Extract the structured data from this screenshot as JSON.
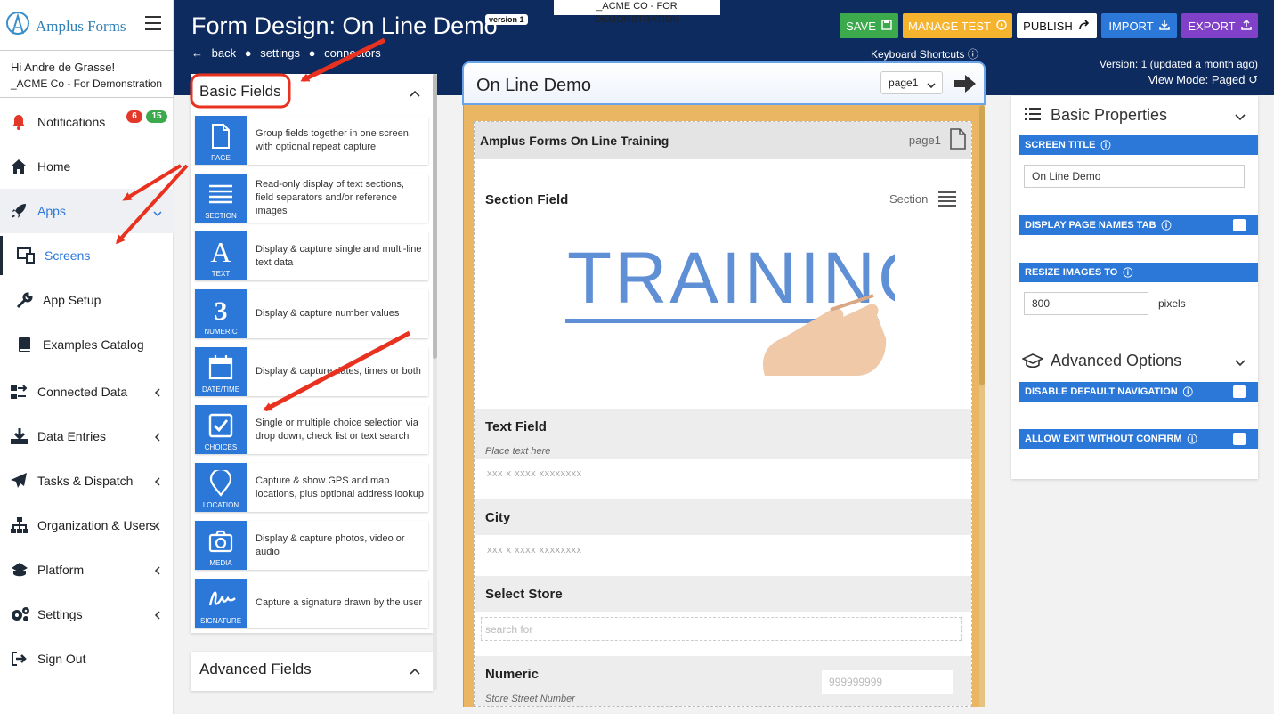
{
  "app": {
    "name": "Amplus Forms"
  },
  "sidebar": {
    "greeting": "Hi Andre de Grasse!",
    "company": "_ACME Co - For Demonstration",
    "items": [
      {
        "label": "Notifications",
        "icon": "bell-icon",
        "badges": [
          "6",
          "15"
        ]
      },
      {
        "label": "Home",
        "icon": "home-icon"
      },
      {
        "label": "Apps",
        "icon": "rocket-icon"
      },
      {
        "label": "Screens",
        "icon": "screens-icon"
      },
      {
        "label": "App Setup",
        "icon": "wrench-icon"
      },
      {
        "label": "Examples Catalog",
        "icon": "book-icon"
      },
      {
        "label": "Connected Data",
        "icon": "connected-data-icon"
      },
      {
        "label": "Data Entries",
        "icon": "download-icon"
      },
      {
        "label": "Tasks & Dispatch",
        "icon": "paper-plane-icon"
      },
      {
        "label": "Organization & Users",
        "icon": "org-chart-icon"
      },
      {
        "label": "Platform",
        "icon": "platform-icon"
      },
      {
        "label": "Settings",
        "icon": "gears-icon"
      },
      {
        "label": "Sign Out",
        "icon": "sign-out-icon"
      }
    ]
  },
  "header": {
    "title": "Form Design: On Line Demo",
    "version_badge": "version 1",
    "breadcrumb": [
      "back",
      "settings",
      "connectors"
    ],
    "demo_banner": "_ACME CO - FOR DEMONSTRATION",
    "buttons": {
      "save": "SAVE",
      "manage_test": "MANAGE TEST",
      "publish": "PUBLISH",
      "import": "IMPORT",
      "export": "EXPORT"
    },
    "keyboard_shortcuts": "Keyboard Shortcuts",
    "version_info": "Version: 1 (updated a month ago)",
    "view_mode": "View Mode: Paged"
  },
  "palette": {
    "basic_title": "Basic Fields",
    "advanced_title": "Advanced Fields",
    "items": [
      {
        "label": "PAGE",
        "desc": "Group fields together in one screen, with optional repeat capture"
      },
      {
        "label": "SECTION",
        "desc": "Read-only display of text sections, field separators and/or reference images"
      },
      {
        "label": "TEXT",
        "desc": "Display & capture single and multi-line text data"
      },
      {
        "label": "NUMERIC",
        "desc": "Display & capture number values"
      },
      {
        "label": "DATE/TIME",
        "desc": "Display & capture dates, times or both"
      },
      {
        "label": "CHOICES",
        "desc": "Single or multiple choice selection via drop down, check list or text search"
      },
      {
        "label": "LOCATION",
        "desc": "Capture & show GPS and map locations, plus optional address lookup"
      },
      {
        "label": "MEDIA",
        "desc": "Display & capture photos, video or audio"
      },
      {
        "label": "SIGNATURE",
        "desc": "Capture a signature drawn by the user"
      }
    ]
  },
  "canvas": {
    "title": "On Line Demo",
    "page_select": "page1",
    "page_header": "Amplus Forms On Line Training",
    "page_label": "page1",
    "section_title": "Section Field",
    "section_label": "Section",
    "image_text": "TRAINING",
    "fields": {
      "text_title": "Text Field",
      "text_placeholder": "Place text here",
      "text_mask": "xxx x xxxx xxxxxxxx",
      "city_title": "City",
      "city_mask": "xxx x xxxx xxxxxxxx",
      "store_title": "Select Store",
      "store_search": "search for",
      "numeric_title": "Numeric",
      "numeric_mask": "999999999",
      "numeric_placeholder": "Store Street Number"
    }
  },
  "properties": {
    "basic_title": "Basic Properties",
    "screen_title_label": "SCREEN TITLE",
    "screen_title_value": "On Line Demo",
    "display_page_names": "DISPLAY PAGE NAMES TAB",
    "resize_images": "RESIZE IMAGES TO",
    "resize_value": "800",
    "pixels": "pixels",
    "advanced_title": "Advanced Options",
    "disable_nav": "DISABLE DEFAULT NAVIGATION",
    "allow_exit": "ALLOW EXIT WITHOUT CONFIRM"
  },
  "colors": {
    "header_bg": "#0d2b5e",
    "accent": "#2b78d9",
    "save": "#3caa4c",
    "manage_test": "#f5b32e",
    "export": "#8040c8",
    "annotation": "#e8321f",
    "canvas_bg": "#eab664"
  }
}
